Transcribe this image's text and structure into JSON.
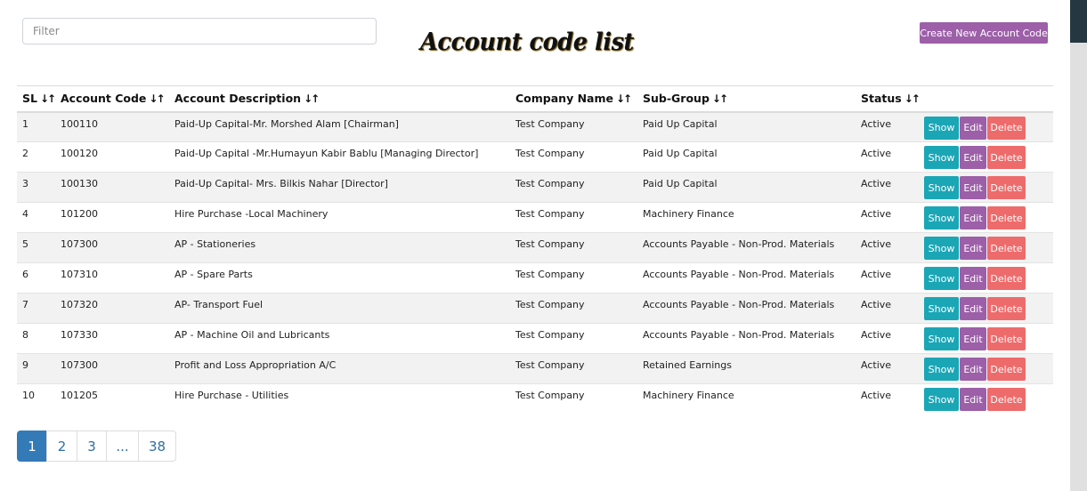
{
  "filter": {
    "placeholder": "Filter",
    "value": ""
  },
  "page": {
    "title": "Account code list"
  },
  "create_button": {
    "label": "Create New Account Code"
  },
  "sort_icon": "sort-arrows-icon",
  "table": {
    "headers": [
      "SL",
      "Account Code",
      "Account Description",
      "Company Name",
      "Sub-Group",
      "Status"
    ],
    "rows": [
      [
        "1",
        "100110",
        "Paid-Up Capital-Mr. Morshed Alam [Chairman]",
        "Test Company",
        "Paid Up Capital",
        "Active"
      ],
      [
        "2",
        "100120",
        "Paid-Up Capital -Mr.Humayun Kabir Bablu [Managing Director]",
        "Test Company",
        "Paid Up Capital",
        "Active"
      ],
      [
        "3",
        "100130",
        "Paid-Up Capital- Mrs. Bilkis Nahar [Director]",
        "Test Company",
        "Paid Up Capital",
        "Active"
      ],
      [
        "4",
        "101200",
        "Hire Purchase -Local Machinery",
        "Test Company",
        "Machinery Finance",
        "Active"
      ],
      [
        "5",
        "107300",
        "AP - Stationeries",
        "Test Company",
        "Accounts Payable - Non-Prod. Materials",
        "Active"
      ],
      [
        "6",
        "107310",
        "AP - Spare Parts",
        "Test Company",
        "Accounts Payable - Non-Prod. Materials",
        "Active"
      ],
      [
        "7",
        "107320",
        "AP- Transport Fuel",
        "Test Company",
        "Accounts Payable - Non-Prod. Materials",
        "Active"
      ],
      [
        "8",
        "107330",
        "AP - Machine Oil and Lubricants",
        "Test Company",
        "Accounts Payable - Non-Prod. Materials",
        "Active"
      ],
      [
        "9",
        "107300",
        "Profit and Loss Appropriation A/C",
        "Test Company",
        "Retained Earnings",
        "Active"
      ],
      [
        "10",
        "101205",
        "Hire Purchase - Utilities",
        "Test Company",
        "Machinery Finance",
        "Active"
      ]
    ],
    "actions": {
      "show": "Show",
      "edit": "Edit",
      "delete": "Delete"
    }
  },
  "pagination": {
    "pages": [
      "1",
      "2",
      "3",
      "...",
      "38"
    ],
    "active_index": 0
  },
  "colors": {
    "show": "#1ba6b6",
    "edit": "#9c5fa8",
    "delete": "#ee6b6b",
    "create": "#9c5fa8",
    "active_page": "#337ab7"
  }
}
